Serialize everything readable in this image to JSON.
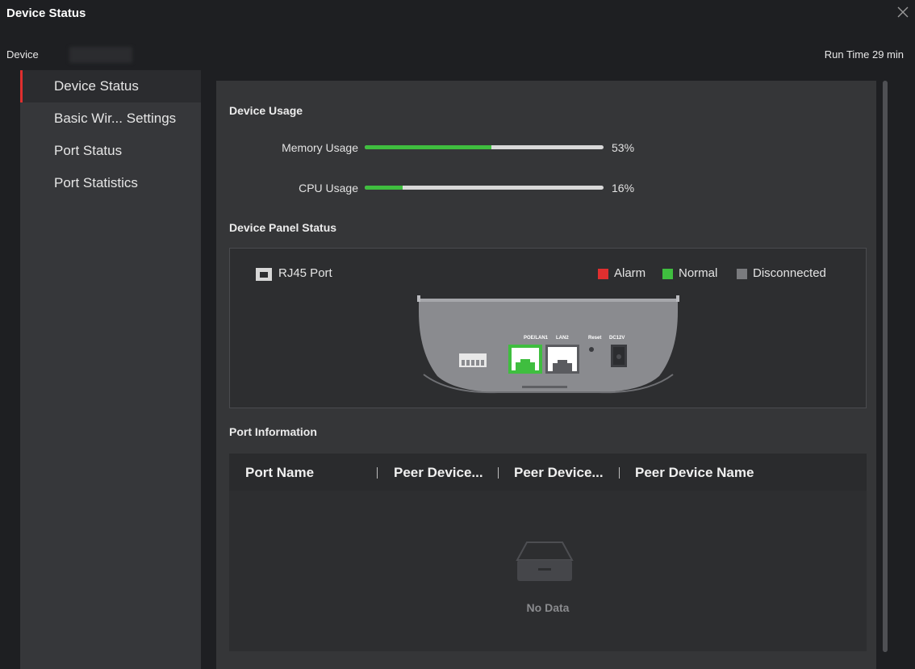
{
  "window": {
    "title": "Device Status"
  },
  "header": {
    "device_label": "Device",
    "run_time": "Run Time 29 min"
  },
  "sidebar": {
    "items": [
      {
        "label": "Device Status",
        "active": true
      },
      {
        "label": "Basic Wir... Settings",
        "active": false
      },
      {
        "label": "Port Status",
        "active": false
      },
      {
        "label": "Port Statistics",
        "active": false
      }
    ]
  },
  "device_usage": {
    "title": "Device Usage",
    "memory": {
      "label": "Memory Usage",
      "value_text": "53%",
      "fraction": 0.53
    },
    "cpu": {
      "label": "CPU Usage",
      "value_text": "16%",
      "fraction": 0.16
    }
  },
  "panel_status": {
    "title": "Device Panel Status",
    "port_type_label": "RJ45 Port",
    "legend": [
      {
        "label": "Alarm",
        "color": "#e02f2f"
      },
      {
        "label": "Normal",
        "color": "#3fbe3f"
      },
      {
        "label": "Disconnected",
        "color": "#7a7b7e"
      }
    ],
    "device_ports": {
      "poe_lan1_label": "POE/LAN1",
      "lan2_label": "LAN2",
      "reset_label": "Reset",
      "dc_label": "DC12V",
      "poe_lan1_status_color": "#3fbe3f",
      "lan2_status_color": "#7a7b7e"
    }
  },
  "port_information": {
    "title": "Port Information",
    "columns": [
      "Port Name",
      "Peer Device...",
      "Peer Device...",
      "Peer Device Name"
    ],
    "empty_text": "No Data"
  },
  "colors": {
    "accent_red": "#e02f2f",
    "accent_green": "#3fbe3f"
  }
}
